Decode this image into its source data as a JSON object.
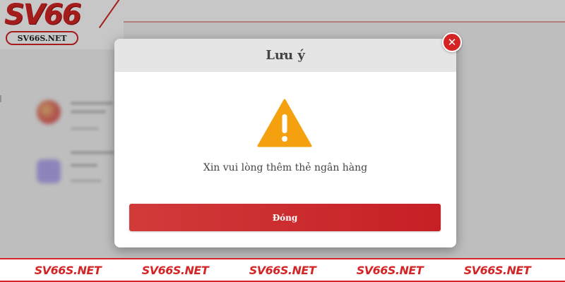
{
  "brand": {
    "logo_text": "SV66",
    "logo_subtext": "SV66S.NET",
    "accent_color": "#d42426"
  },
  "background": {
    "nav_items": [
      "",
      "",
      "",
      "",
      "",
      "",
      ""
    ]
  },
  "dialog": {
    "title": "Lưu ý",
    "icon": "warning-triangle-icon",
    "message": "Xin vui lòng thêm thẻ ngân hàng",
    "button_label": "Đóng",
    "close_icon": "close-icon",
    "close_symbol": "✕"
  },
  "watermark": {
    "items": [
      "SV66S.NET",
      "SV66S.NET",
      "SV66S.NET",
      "SV66S.NET",
      "SV66S.NET"
    ]
  }
}
